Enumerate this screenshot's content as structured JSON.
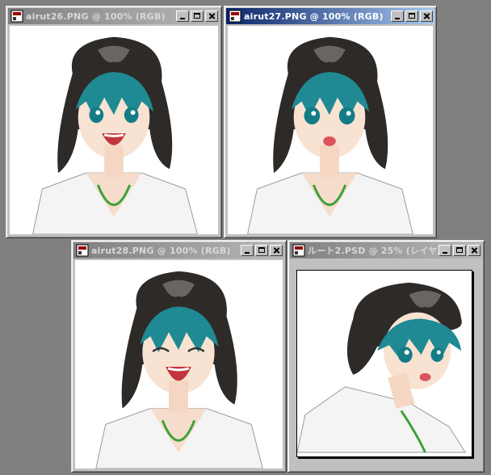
{
  "windows": [
    {
      "title": "airut26.PNG @ 100% (RGB)",
      "active": false,
      "expression": "open-mouth-smile"
    },
    {
      "title": "airut27.PNG @ 100% (RGB)",
      "active": true,
      "expression": "surprised"
    },
    {
      "title": "airut28.PNG @ 100% (RGB)",
      "active": false,
      "expression": "closed-eye-laugh"
    },
    {
      "title": "ルート2.PSD @ 25% (レイヤ...",
      "active": false,
      "expression": "surprised-turned"
    }
  ],
  "icons": {
    "window": "photoshop-document-icon",
    "minimize": "minimize-icon",
    "maximize": "maximize-icon",
    "close": "close-icon"
  },
  "colors": {
    "desktop": "#808080",
    "active_title": "#0a246a",
    "inactive_title": "#808080",
    "hair": "#1f8a94",
    "bandana": "#2e2a26"
  }
}
